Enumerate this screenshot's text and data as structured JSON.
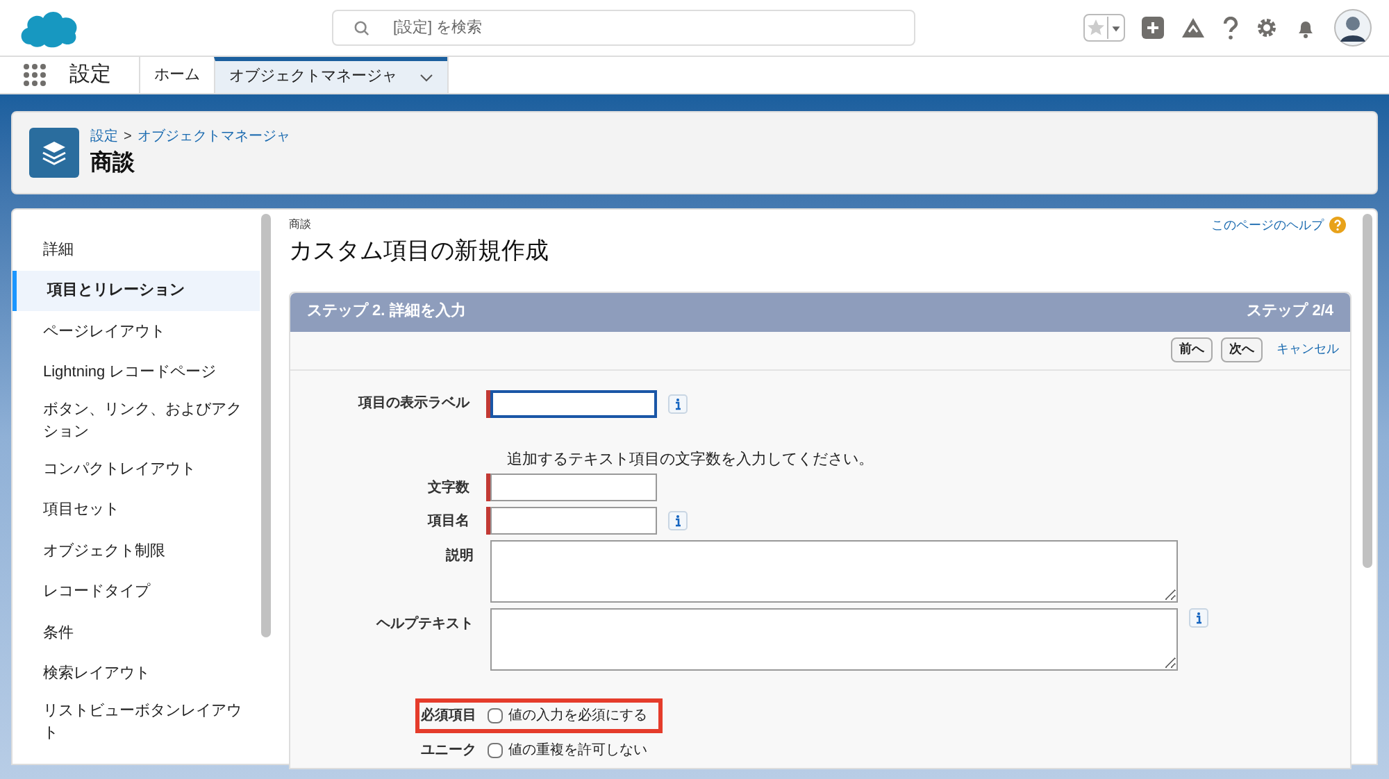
{
  "search": {
    "placeholder": "[設定] を検索"
  },
  "nav": {
    "app_name": "設定",
    "tabs": [
      {
        "label": "ホーム",
        "selected": false
      },
      {
        "label": "オブジェクトマネージャ",
        "selected": true
      }
    ]
  },
  "header": {
    "breadcrumb": [
      {
        "label": "設定"
      },
      {
        "label": "オブジェクトマネージャ"
      }
    ],
    "separator": ">",
    "title": "商談"
  },
  "sidebar": {
    "items": [
      {
        "label": "詳細",
        "selected": false
      },
      {
        "label": "項目とリレーション",
        "selected": true
      },
      {
        "label": "ページレイアウト",
        "selected": false
      },
      {
        "label": "Lightning レコードページ",
        "selected": false
      },
      {
        "label": "ボタン、リンク、およびアクション",
        "selected": false
      },
      {
        "label": "コンパクトレイアウト",
        "selected": false
      },
      {
        "label": "項目セット",
        "selected": false
      },
      {
        "label": "オブジェクト制限",
        "selected": false
      },
      {
        "label": "レコードタイプ",
        "selected": false
      },
      {
        "label": "条件",
        "selected": false
      },
      {
        "label": "検索レイアウト",
        "selected": false
      },
      {
        "label": "リストビューボタンレイアウト",
        "selected": false
      }
    ]
  },
  "content": {
    "object": "商談",
    "title": "カスタム項目の新規作成",
    "help_link": "このページのヘルプ",
    "step": {
      "title": "ステップ 2. 詳細を入力",
      "counter": "ステップ 2/4"
    },
    "buttons": [
      {
        "label": "前へ",
        "kind": "button"
      },
      {
        "label": "次へ",
        "kind": "button"
      },
      {
        "label": "キャンセル",
        "kind": "link"
      }
    ],
    "fields": [
      {
        "kind": "text",
        "label": "項目の表示ラベル",
        "required": true,
        "focused": true,
        "info": true
      },
      {
        "kind": "note",
        "text": "追加するテキスト項目の文字数を入力してください。"
      },
      {
        "kind": "text",
        "label": "文字数",
        "required": true,
        "focused": false,
        "info": false
      },
      {
        "kind": "text",
        "label": "項目名",
        "required": true,
        "focused": false,
        "info": true
      },
      {
        "kind": "textarea",
        "label": "説明",
        "info": false
      },
      {
        "kind": "textarea",
        "label": "ヘルプテキスト",
        "info": true
      },
      {
        "kind": "checkbox",
        "label": "必須項目",
        "text": "値の入力を必須にする",
        "checked": false,
        "highlighted": true
      },
      {
        "kind": "checkbox",
        "label": "ユニーク",
        "text": "値の重複を許可しない",
        "checked": false,
        "highlighted": false
      }
    ]
  }
}
